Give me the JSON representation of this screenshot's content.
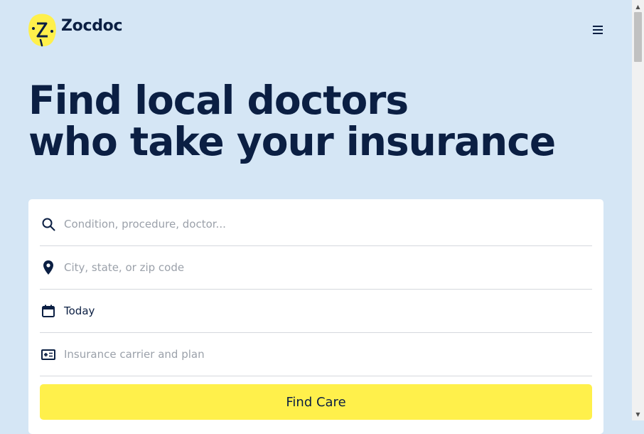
{
  "brand": {
    "name": "Zocdoc",
    "logo_letter": "Z",
    "logo_color": "#fff04b"
  },
  "header": {
    "menu_icon": "hamburger-menu-icon"
  },
  "hero": {
    "line1": "Find local doctors",
    "line2": "who take your insurance"
  },
  "search": {
    "condition": {
      "placeholder": "Condition, procedure, doctor...",
      "icon": "search-icon"
    },
    "location": {
      "placeholder": "City, state, or zip code",
      "icon": "location-pin-icon"
    },
    "date": {
      "value": "Today",
      "icon": "calendar-icon"
    },
    "insurance": {
      "placeholder": "Insurance carrier and plan",
      "icon": "insurance-card-icon"
    },
    "submit_label": "Find Care"
  },
  "colors": {
    "background": "#d5e6f5",
    "text": "#0b1f43",
    "button": "#fff04b"
  }
}
